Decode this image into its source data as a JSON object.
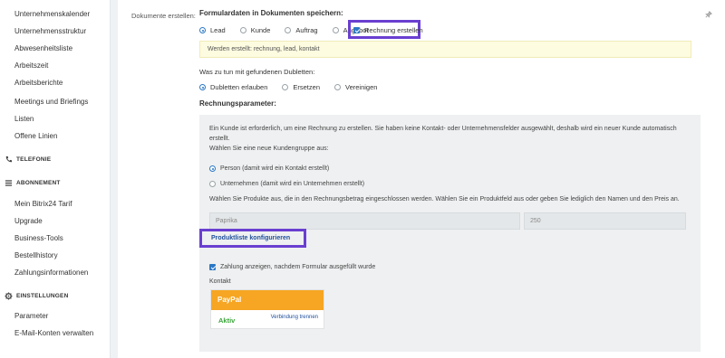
{
  "sidebar": {
    "items_top": [
      "Unternehmenskalender",
      "Unternehmensstruktur",
      "Abwesenheitsliste",
      "Arbeitszeit",
      "Arbeitsberichte",
      "Meetings und Briefings",
      "Listen",
      "Offene Linien"
    ],
    "section_telefonie": "TELEFONIE",
    "section_abonnement": "ABONNEMENT",
    "items_abonnement": [
      "Mein Bitrix24 Tarif",
      "Upgrade",
      "Business-Tools",
      "Bestellhistory",
      "Zahlungsinformationen"
    ],
    "section_einstellungen": "EINSTELLUNGEN",
    "items_einstellungen": [
      "Parameter",
      "E-Mail-Konten verwalten"
    ]
  },
  "main": {
    "docs_label": "Dokumente erstellen:",
    "form_heading": "Formulardaten in Dokumenten speichern:",
    "doc_options": [
      "Lead",
      "Kunde",
      "Auftrag",
      "Angebot"
    ],
    "invoice_checkbox": "Rechnung erstellen",
    "created_info": "Werden erstellt: rechnung, lead, kontakt",
    "duplicates_question": "Was zu tun mit gefundenen Dubletten:",
    "duplicate_options": [
      "Dubletten erlauben",
      "Ersetzen",
      "Vereinigen"
    ],
    "invoice_params_heading": "Rechnungsparameter:",
    "info_line1": "Ein Kunde ist erforderlich, um eine Rechnung zu erstellen. Sie haben keine Kontakt- oder Unternehmensfelder ausgewählt, deshalb wird ein neuer Kunde automatisch",
    "info_line2": "erstellt.",
    "info_line3": "Wählen Sie eine neue Kundengruppe aus:",
    "group_person": "Person (damit wird ein Kontakt erstellt)",
    "group_company": "Unternehmen (damit wird ein Unternehmen erstellt)",
    "products_text": "Wählen Sie Produkte aus, die in den Rechnungsbetrag eingeschlossen werden. Wählen Sie ein Produktfeld aus oder geben Sie lediglich den Namen und den Preis an.",
    "product_name": "Paprika",
    "product_price": "250",
    "configure_link": "Produktliste konfigurieren",
    "show_payment": "Zahlung anzeigen, nachdem Formular ausgefüllt wurde",
    "contact_label": "Kontakt",
    "paypal_title": "PayPal",
    "paypal_status": "Aktiv",
    "paypal_disconnect": "Verbindung trennen"
  },
  "colors": {
    "highlight": "#6a3fd0",
    "accent_blue": "#2b78c5",
    "paypal_orange": "#f6a623",
    "active_green": "#3aa53a"
  }
}
